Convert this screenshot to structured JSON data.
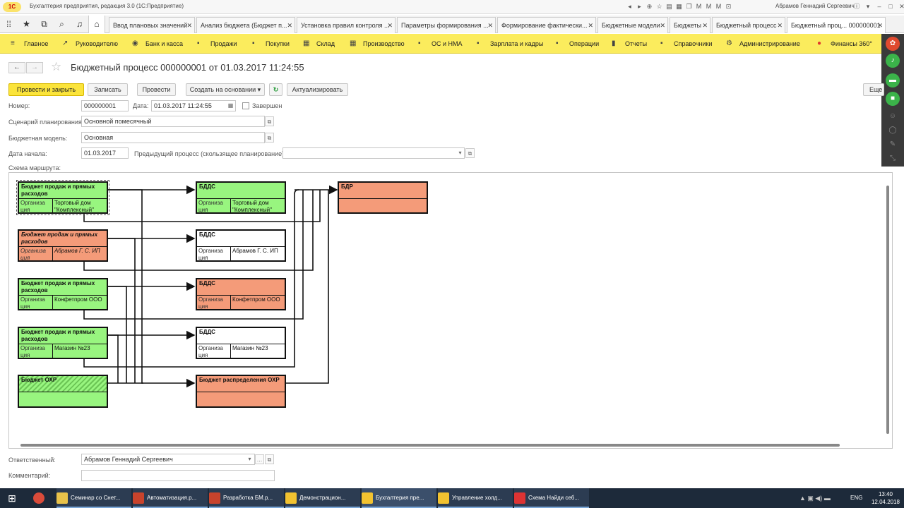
{
  "titlebar": {
    "logo": "1С",
    "app_title": "Бухгалтерия предприятия, редакция 3.0  (1С:Предприятие)",
    "user": "Абрамов Геннадий Сергеевич"
  },
  "tabs": [
    {
      "label": "Ввод плановых значений"
    },
    {
      "label": "Анализ бюджета (Бюджет п..."
    },
    {
      "label": "Установка правил контроля ..."
    },
    {
      "label": "Параметры формирования ..."
    },
    {
      "label": "Формирование фактически..."
    },
    {
      "label": "Бюджетные модели"
    },
    {
      "label": "Бюджеты"
    },
    {
      "label": "Бюджетный процесс"
    },
    {
      "label": "Бюджетный проц... 000000001"
    }
  ],
  "sections": [
    {
      "label": "Главное",
      "icon": "≡"
    },
    {
      "label": "Руководителю",
      "icon": "↗"
    },
    {
      "label": "Банк и касса",
      "icon": "◉"
    },
    {
      "label": "Продажи",
      "icon": "▪"
    },
    {
      "label": "Покупки",
      "icon": "▪"
    },
    {
      "label": "Склад",
      "icon": "▦"
    },
    {
      "label": "Производство",
      "icon": "▦"
    },
    {
      "label": "ОС и НМА",
      "icon": "▪"
    },
    {
      "label": "Зарплата и кадры",
      "icon": "▪"
    },
    {
      "label": "Операции",
      "icon": "▪"
    },
    {
      "label": "Отчеты",
      "icon": "▮"
    },
    {
      "label": "Справочники",
      "icon": "▪"
    },
    {
      "label": "Администрирование",
      "icon": "⚙"
    },
    {
      "label": "Финансы 360°",
      "icon": "●"
    }
  ],
  "document": {
    "title": "Бюджетный процесс 000000001 от 01.03.2017 11:24:55"
  },
  "toolbar": {
    "post_close": "Провести и закрыть",
    "save": "Записать",
    "post": "Провести",
    "create_based": "Создать на основании",
    "refresh_icon": "↻",
    "actualize": "Актуализировать",
    "more": "Еще"
  },
  "form": {
    "number_label": "Номер:",
    "number_value": "000000001",
    "date_label": "Дата:",
    "date_value": "01.03.2017 11:24:55",
    "completed_label": "Завершен",
    "scenario_label": "Сценарий планирования:",
    "scenario_value": "Основной помесячный",
    "model_label": "Бюджетная модель:",
    "model_value": "Основная",
    "start_label": "Дата начала:",
    "start_value": "01.03.2017",
    "prev_label": "Предыдущий процесс (скользящее планирование):",
    "prev_value": "",
    "scheme_label": "Схема маршрута:",
    "responsible_label": "Ответственный:",
    "responsible_value": "Абрамов Геннадий Сергеевич",
    "comment_label": "Комментарий:",
    "comment_value": ""
  },
  "scheme": {
    "org_label": "Организа ция",
    "nodes": [
      {
        "title": "Бюджет продаж и прямых расходов",
        "org": "Торговый дом \"Комплексный\"",
        "color": "green"
      },
      {
        "title": "Бюджет продаж и прямых расходов",
        "org": "Абрамов Г. С. ИП",
        "color": "salmon"
      },
      {
        "title": "Бюджет продаж и прямых расходов",
        "org": "Конфетпром ООО",
        "color": "green"
      },
      {
        "title": "Бюджет продаж и прямых расходов",
        "org": "Магазин №23",
        "color": "green"
      },
      {
        "title": "Бюджет ОХР",
        "org": "",
        "color": "green"
      },
      {
        "title": "БДДС",
        "org": "Торговый дом \"Комплексный\"",
        "color": "green"
      },
      {
        "title": "БДДС",
        "org": "Абрамов Г. С. ИП",
        "color": "white"
      },
      {
        "title": "БДДС",
        "org": "Конфетпром ООО",
        "color": "salmon"
      },
      {
        "title": "БДДС",
        "org": "Магазин №23",
        "color": "white"
      },
      {
        "title": "Бюджет распределения ОХР",
        "org": "",
        "color": "salmon"
      },
      {
        "title": "БДР",
        "org": "",
        "color": "salmon"
      }
    ]
  },
  "taskbar": {
    "apps": [
      {
        "label": "Семинар со Снет...",
        "color": "#e8c24a"
      },
      {
        "label": "Автоматизация.р...",
        "color": "#c8432c"
      },
      {
        "label": "Разработка БМ.р...",
        "color": "#c8432c"
      },
      {
        "label": "Демонстрацион...",
        "color": "#f2c230"
      },
      {
        "label": "Бухгалтерия пре...",
        "color": "#f2c230"
      },
      {
        "label": "Управление холд...",
        "color": "#f2c230"
      },
      {
        "label": "Схема Найди себ...",
        "color": "#d33"
      }
    ],
    "lang": "ENG",
    "time": "13:40",
    "date": "12.04.2018"
  }
}
